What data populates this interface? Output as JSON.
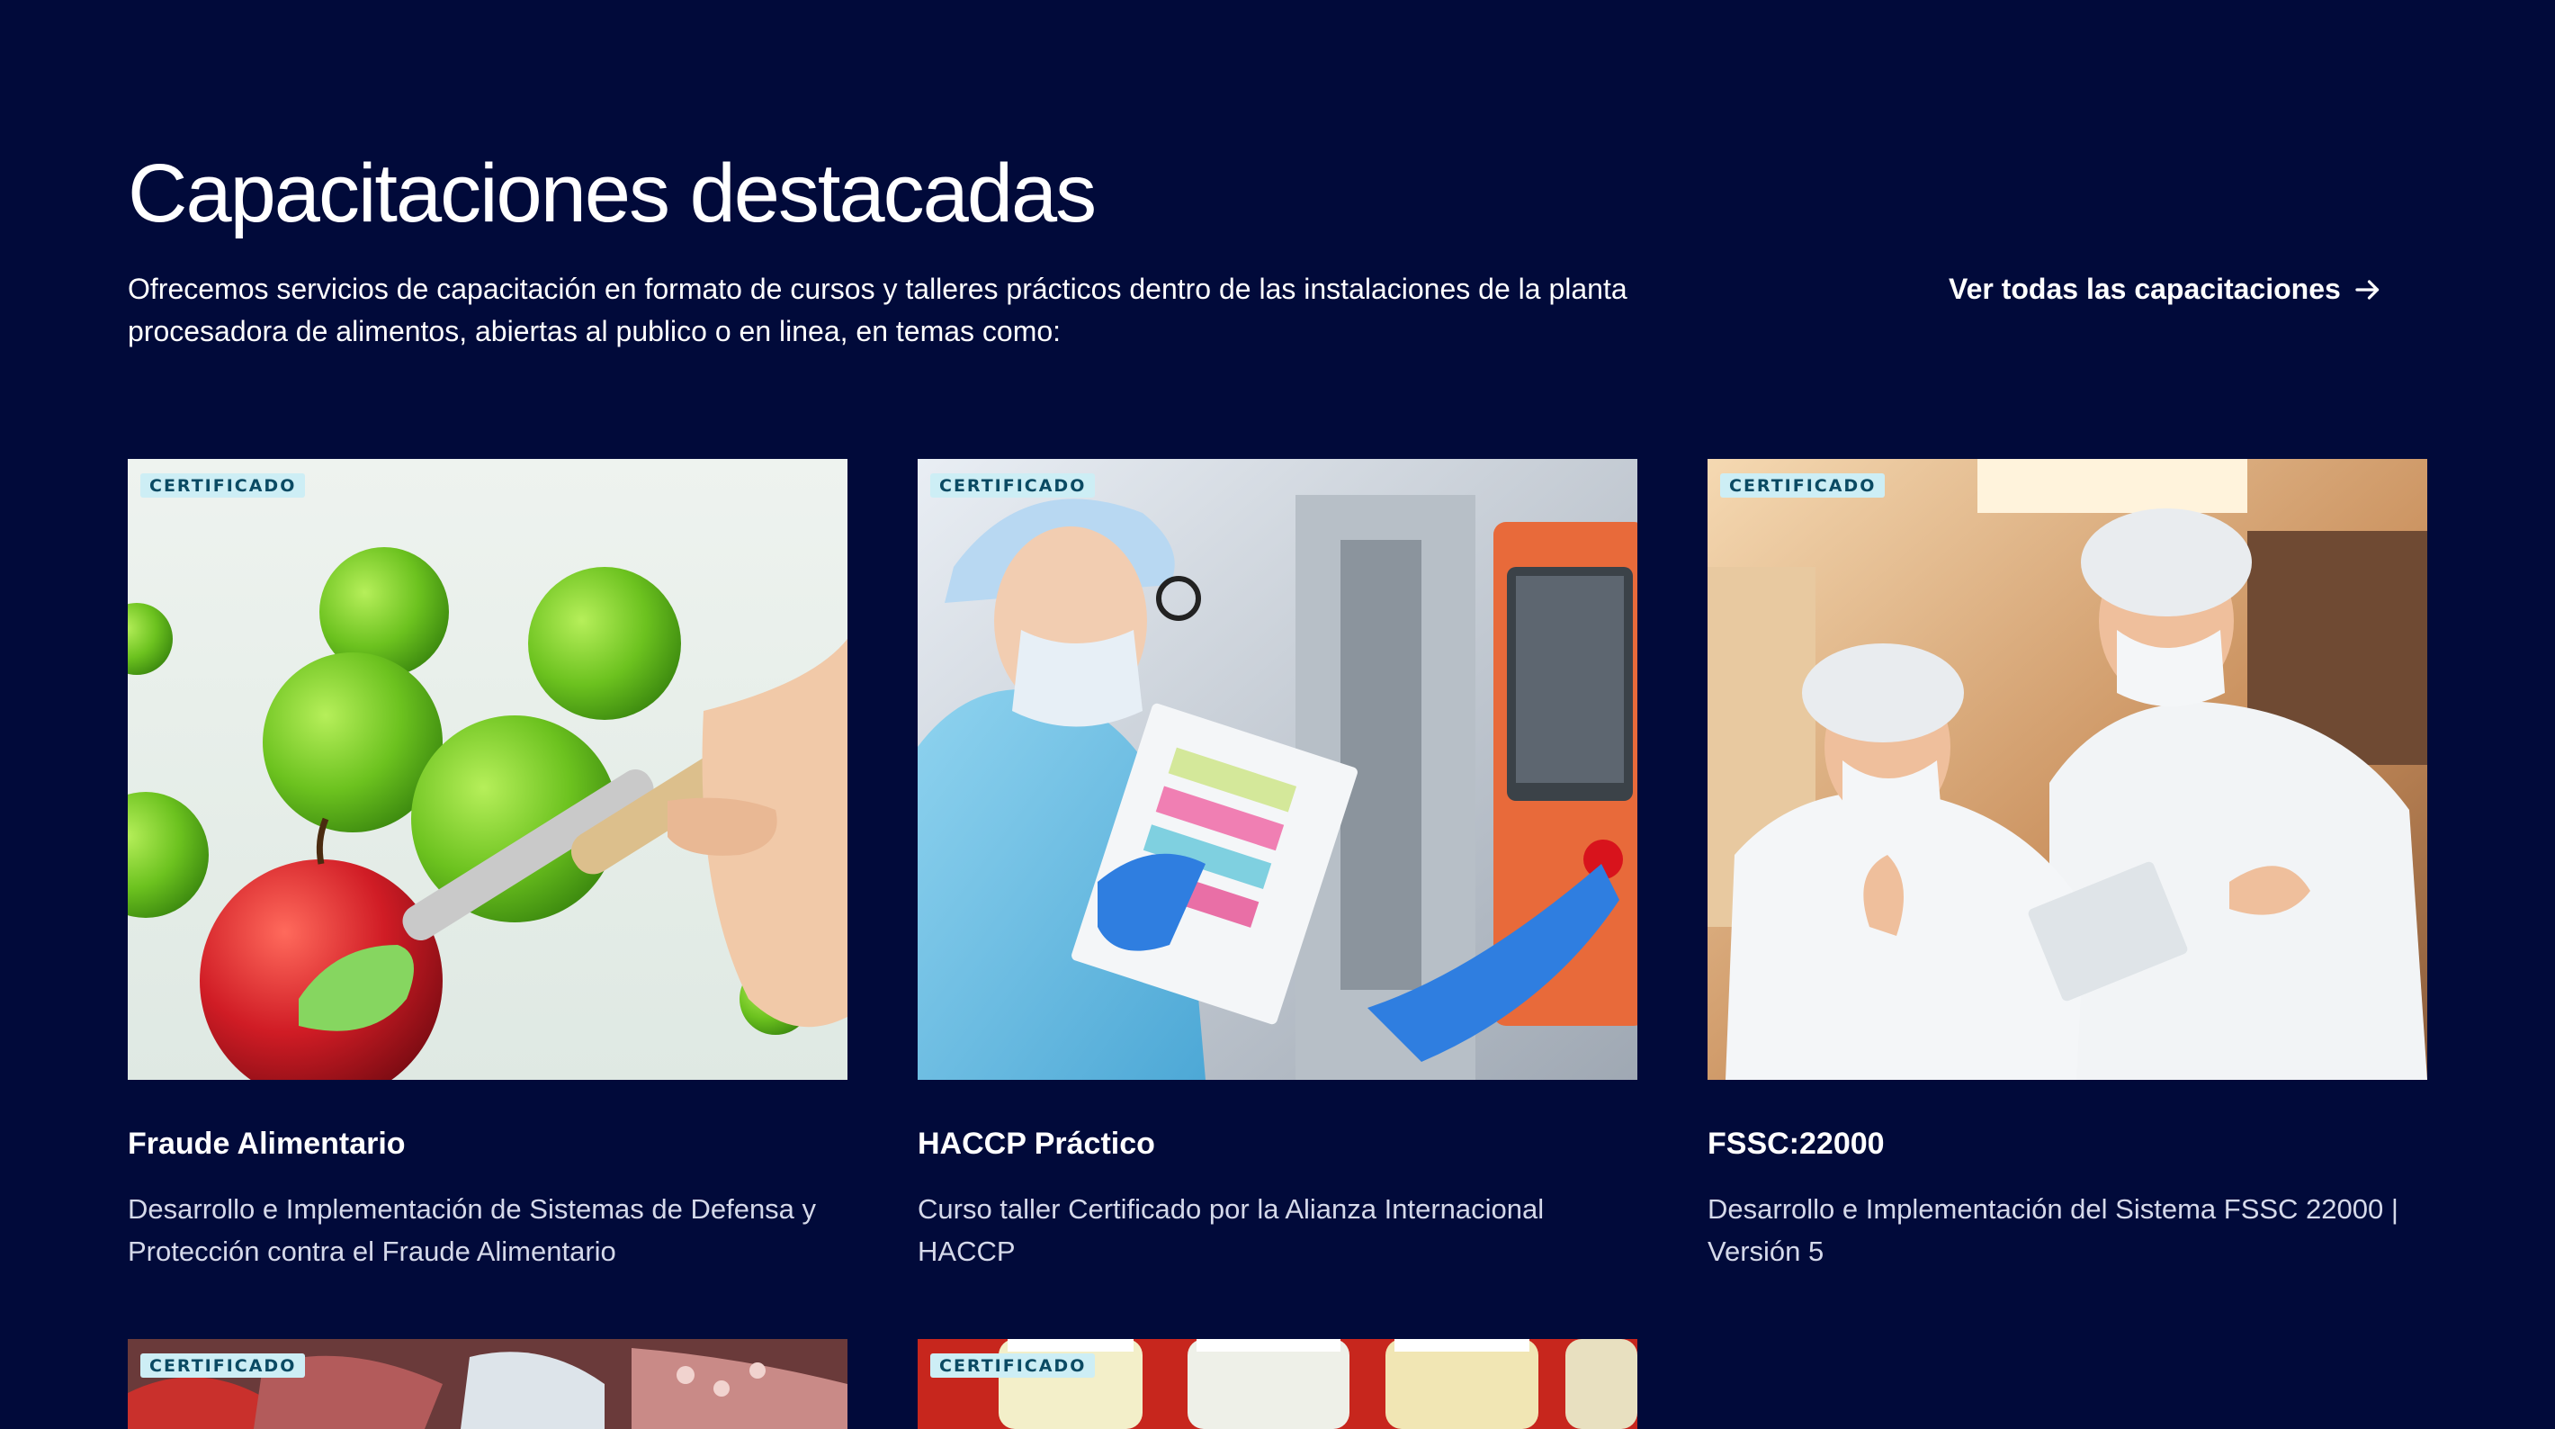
{
  "section": {
    "title": "Capacitaciones destacadas",
    "intro": "Ofrecemos servicios de capacitación en formato de cursos y talleres prácticos dentro de las instalaciones de la planta procesadora de alimentos, abiertas al publico o en linea, en temas como:",
    "view_all": "Ver todas las capacitaciones"
  },
  "colors": {
    "background": "#010a3a",
    "badge_bg": "#cdeef5",
    "badge_text": "#0a4a63"
  },
  "cards": [
    {
      "badge": "CERTIFICADO",
      "title": "Fraude Alimentario",
      "description": "Desarrollo e Implementación de Sistemas de Defensa y Protección contra el Fraude Alimentario",
      "image": "apples-paintbrush-image"
    },
    {
      "badge": "CERTIFICADO",
      "title": "HACCP Práctico",
      "description": "Curso taller Certificado por la Alianza Internacional HACCP",
      "image": "lab-technician-image"
    },
    {
      "badge": "CERTIFICADO",
      "title": "FSSC:22000",
      "description": "Desarrollo e Implementación del Sistema FSSC 22000 | Versión 5",
      "image": "food-inspectors-image"
    },
    {
      "badge": "CERTIFICADO",
      "image": "seafood-image"
    },
    {
      "badge": "CERTIFICADO",
      "image": "preserved-jars-image"
    }
  ]
}
